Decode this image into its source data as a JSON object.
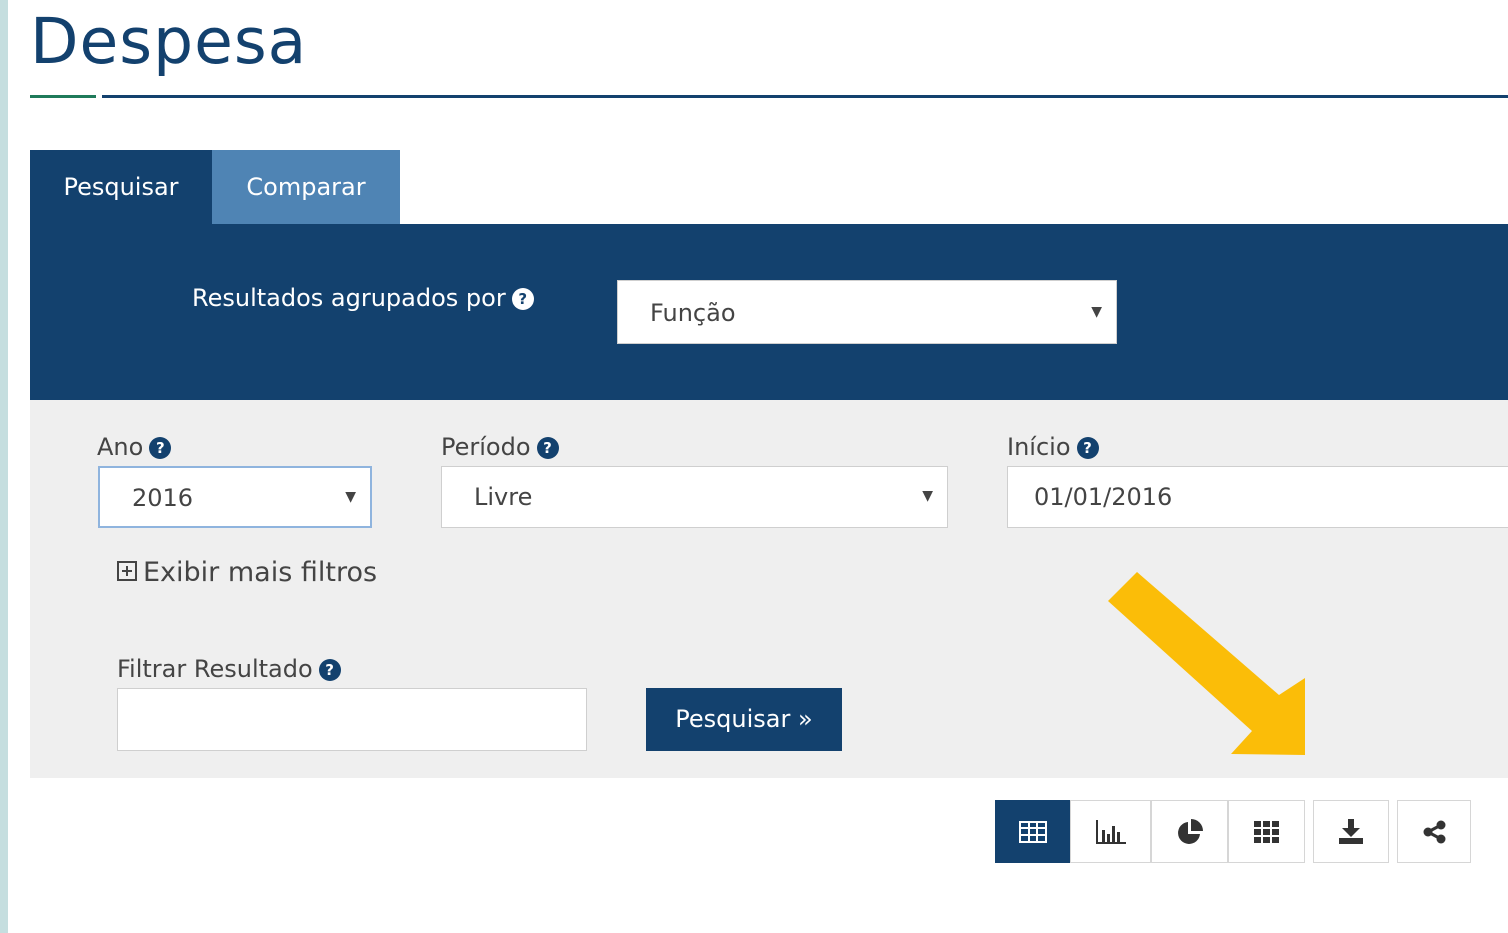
{
  "page": {
    "title": "Despesa"
  },
  "tabs": [
    {
      "label": "Pesquisar",
      "active": true
    },
    {
      "label": "Comparar",
      "active": false
    }
  ],
  "group_by": {
    "label": "Resultados agrupados por",
    "value": "Função"
  },
  "filters": {
    "ano": {
      "label": "Ano",
      "value": "2016"
    },
    "periodo": {
      "label": "Período",
      "value": "Livre"
    },
    "inicio": {
      "label": "Início",
      "value": "01/01/2016"
    },
    "more_filters_label": "Exibir mais filtros",
    "filtrar_resultado": {
      "label": "Filtrar Resultado",
      "value": ""
    },
    "search_button_label": "Pesquisar »"
  },
  "help_glyph": "?",
  "view_toolbar": {
    "buttons": [
      {
        "icon": "table-icon",
        "active": true
      },
      {
        "icon": "bar-chart-icon",
        "active": false
      },
      {
        "icon": "pie-chart-icon",
        "active": false
      },
      {
        "icon": "grid-icon",
        "active": false
      },
      {
        "icon": "download-icon",
        "active": false
      },
      {
        "icon": "share-icon",
        "active": false
      }
    ]
  },
  "colors": {
    "primary": "#13416e",
    "tab_inactive": "#4f84b4",
    "panel_bg": "#efefef",
    "annotation_arrow": "#fbbd08"
  }
}
